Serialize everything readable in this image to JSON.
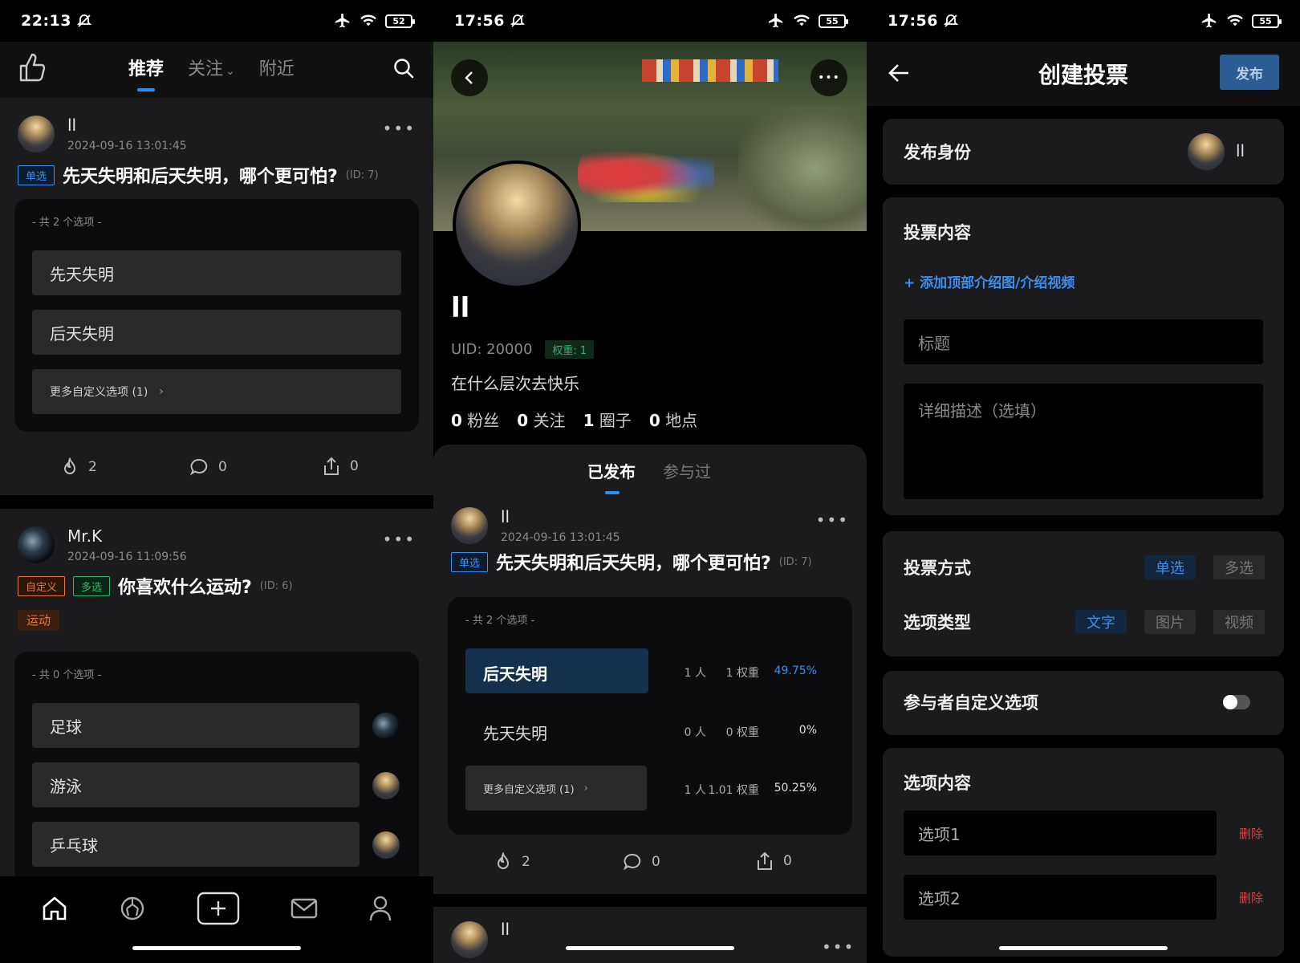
{
  "p1": {
    "status": {
      "time": "22:13",
      "battery": "52"
    },
    "tabs": {
      "t1": "推荐",
      "t2": "关注",
      "t3": "附近"
    },
    "post1": {
      "user": "ll",
      "time": "2024-09-16 13:01:45",
      "tag": "单选",
      "title": "先天失明和后天失明，哪个更可怕?",
      "id": "(ID: 7)",
      "count": "- 共 2 个选项 -",
      "opt1": "先天失明",
      "opt2": "后天失明",
      "opt3": "更多自定义选项 (1)",
      "likes": "2",
      "comments": "0",
      "shares": "0"
    },
    "post2": {
      "user": "Mr.K",
      "time": "2024-09-16 11:09:56",
      "tag1": "自定义",
      "tag2": "多选",
      "title": "你喜欢什么运动?",
      "id": "(ID: 6)",
      "topic": "运动",
      "count": "- 共 0 个选项 -",
      "opt1": "足球",
      "opt2": "游泳",
      "opt3": "乒乓球"
    }
  },
  "p2": {
    "status": {
      "time": "17:56",
      "battery": "55"
    },
    "name": "ll",
    "uid": "UID: 20000",
    "weight": "权重: 1",
    "bio": "在什么层次去快乐",
    "stats": {
      "fans_n": "0",
      "fans": "粉丝",
      "follow_n": "0",
      "follow": "关注",
      "circle_n": "1",
      "circle": "圈子",
      "place_n": "0",
      "place": "地点"
    },
    "tabs": {
      "t1": "已发布",
      "t2": "参与过"
    },
    "post": {
      "user": "ll",
      "time": "2024-09-16 13:01:45",
      "tag": "单选",
      "title": "先天失明和后天失明，哪个更可怕?",
      "id": "(ID: 7)",
      "count": "- 共 2 个选项 -",
      "r1": {
        "label": "后天失明",
        "people": "1 人",
        "weight": "1 权重",
        "pct": "49.75%"
      },
      "r2": {
        "label": "先天失明",
        "people": "0 人",
        "weight": "0 权重",
        "pct": "0%"
      },
      "r3": {
        "label": "更多自定义选项 (1)",
        "people": "1 人",
        "weight": "1.01 权重",
        "pct": "50.25%"
      },
      "likes": "2",
      "comments": "0",
      "shares": "0"
    },
    "next_user": "ll"
  },
  "p3": {
    "status": {
      "time": "17:56",
      "battery": "55"
    },
    "title": "创建投票",
    "publish": "发布",
    "identity_label": "发布身份",
    "identity_user": "ll",
    "content_label": "投票内容",
    "add_media": "+ 添加顶部介绍图/介绍视频",
    "title_placeholder": "标题",
    "desc_placeholder": "详细描述（选填）",
    "mode_label": "投票方式",
    "mode_single": "单选",
    "mode_multi": "多选",
    "type_label": "选项类型",
    "type_text": "文字",
    "type_image": "图片",
    "type_video": "视频",
    "custom_label": "参与者自定义选项",
    "options_label": "选项内容",
    "opt1": "选项1",
    "opt2": "选项2",
    "delete": "删除"
  },
  "colors": {
    "accent": "#2d8ef2",
    "card": "#1b1b1d",
    "delete": "#c94848"
  }
}
